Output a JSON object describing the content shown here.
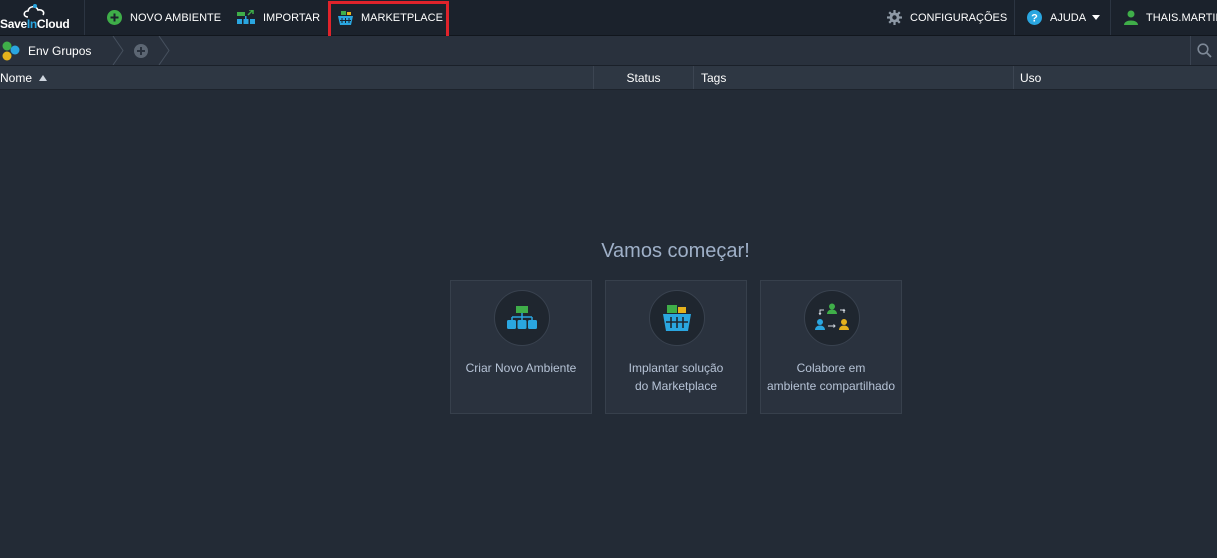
{
  "app": {
    "logo_part1": "Save",
    "logo_part2": "In",
    "logo_part3": "Cloud"
  },
  "toolbar": {
    "new_env_label": "NOVO AMBIENTE",
    "import_label": "IMPORTAR",
    "marketplace_label": "MARKETPLACE",
    "settings_label": "CONFIGURAÇÕES",
    "help_label": "AJUDA",
    "user_label": "THAIS.MARTINS"
  },
  "groups": {
    "current_label": "Env Grupos"
  },
  "table": {
    "columns": [
      "Nome",
      "Status",
      "Tags",
      "Uso"
    ]
  },
  "empty_state": {
    "heading": "Vamos começar!",
    "cards": [
      {
        "line1": "Criar Novo Ambiente",
        "line2": ""
      },
      {
        "line1": "Implantar solução",
        "line2": "do Marketplace"
      },
      {
        "line1": "Colabore em",
        "line2": "ambiente compartilhado"
      }
    ]
  },
  "colors": {
    "highlight": "#e0232b",
    "accent_green": "#3fae49",
    "accent_blue": "#2aa6e0"
  }
}
